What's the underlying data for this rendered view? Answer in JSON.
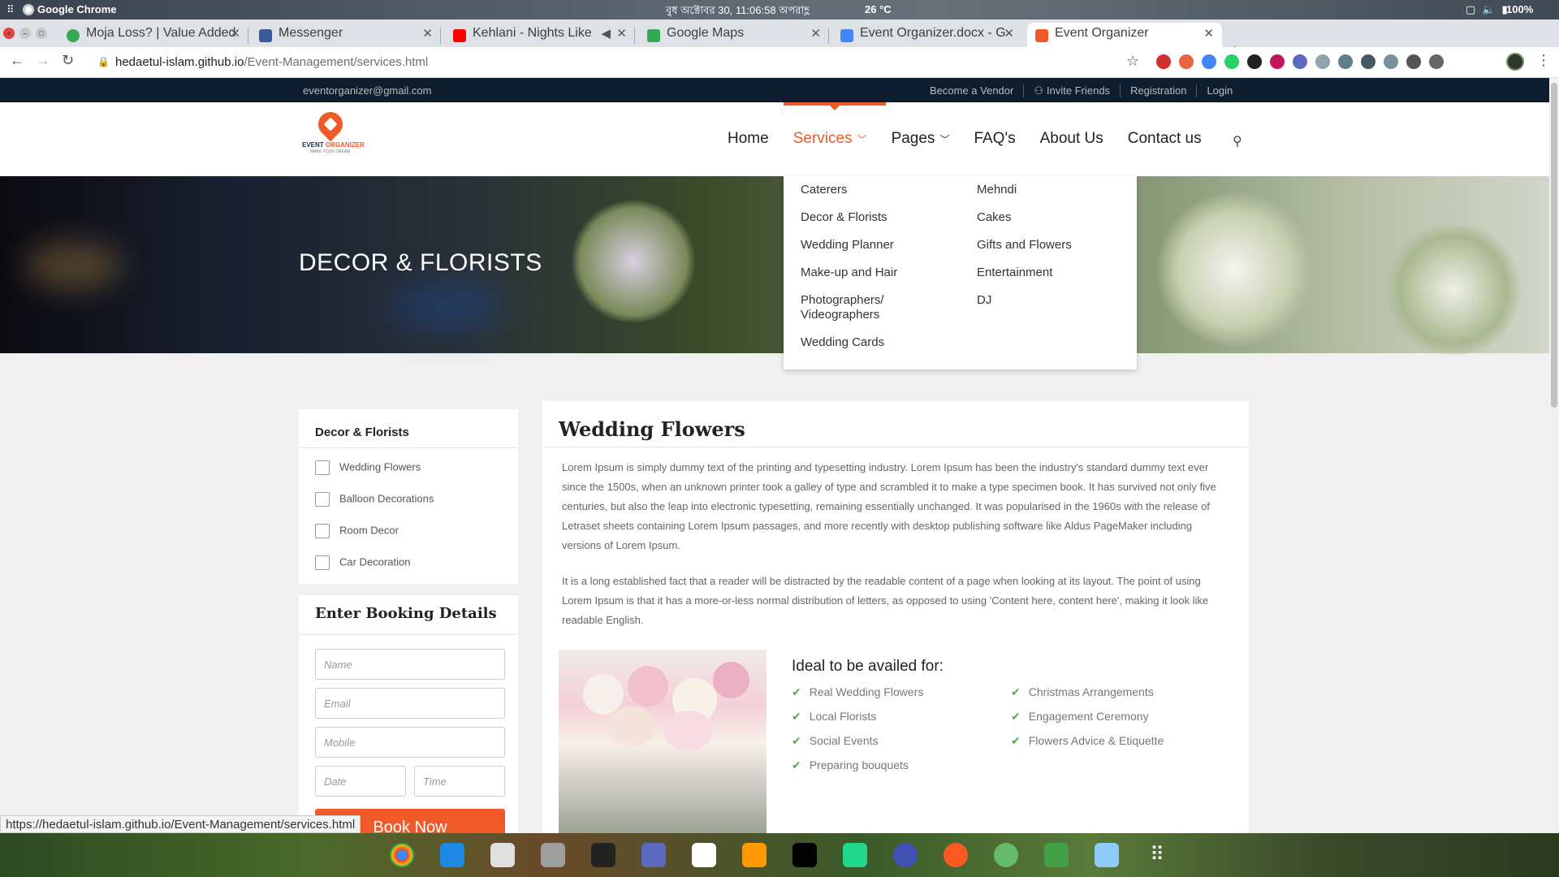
{
  "system": {
    "app_name": "Google Chrome",
    "clock": "বুধ অক্টোবর 30, 11:06:58 অপরাহ্ণ",
    "temperature": "26 °C",
    "battery": "100%"
  },
  "tabs": [
    {
      "title": "Moja Loss? | Value Added",
      "color": "#34a853"
    },
    {
      "title": "Messenger",
      "color": "#3b5998"
    },
    {
      "title": "Kehlani - Nights Like",
      "color": "#ff0000"
    },
    {
      "title": "Google Maps",
      "color": "#34a853"
    },
    {
      "title": "Event Organizer.docx - G",
      "color": "#4285f4"
    },
    {
      "title": "Event Organizer",
      "color": "#f05a28"
    }
  ],
  "address": {
    "host": "hedaetul-islam.github.io",
    "path": "/Event-Management/services.html"
  },
  "topbar": {
    "email": "eventorganizer@gmail.com",
    "links": [
      "Become a Vendor",
      "Invite Friends",
      "Registration",
      "Login"
    ]
  },
  "logo": {
    "brand_a": "EVENT",
    "brand_b": "ORGANIZER",
    "tagline": "MAKE YOUR DREAM"
  },
  "menu": {
    "home": "Home",
    "services": "Services",
    "pages": "Pages",
    "faq": "FAQ's",
    "about": "About Us",
    "contact": "Contact us"
  },
  "hero_title": "DECOR & FLORISTS",
  "dropdown": {
    "col1": [
      "Caterers",
      "Decor & Florists",
      "Wedding Planner",
      "Make-up and Hair",
      "Photographers/",
      "Videographers",
      "Wedding Cards"
    ],
    "col2": [
      "Mehndi",
      "Cakes",
      "Gifts and Flowers",
      "Entertainment",
      "DJ"
    ]
  },
  "sidebar": {
    "title": "Decor & Florists",
    "options": [
      "Wedding Flowers",
      "Balloon Decorations",
      "Room Decor",
      "Car Decoration"
    ]
  },
  "booking": {
    "title": "Enter Booking Details",
    "name_ph": "Name",
    "email_ph": "Email",
    "mobile_ph": "Mobile",
    "date_ph": "Date",
    "time_ph": "Time",
    "button": "Book Now"
  },
  "main": {
    "title": "Wedding Flowers",
    "para1": "Lorem Ipsum is simply dummy text of the printing and typesetting industry. Lorem Ipsum has been the industry's standard dummy text ever since the 1500s, when an unknown printer took a galley of type and scrambled it to make a type specimen book. It has survived not only five centuries, but also the leap into electronic typesetting, remaining essentially unchanged. It was popularised in the 1960s with the release of Letraset sheets containing Lorem Ipsum passages, and more recently with desktop publishing software like Aldus PageMaker including versions of Lorem Ipsum.",
    "para2": "It is a long established fact that a reader will be distracted by the readable content of a page when looking at its layout. The point of using Lorem Ipsum is that it has a more-or-less normal distribution of letters, as opposed to using 'Content here, content here', making it look like readable English.",
    "ideal_title": "Ideal to be availed for:",
    "features_left": [
      "Real Wedding Flowers",
      "Local Florists",
      "Social Events",
      "Preparing bouquets"
    ],
    "features_right": [
      "Christmas Arrangements",
      "Engagement Ceremony",
      "Flowers Advice & Etiquette"
    ]
  },
  "status_url": "https://hedaetul-islam.github.io/Event-Management/services.html",
  "colors": {
    "accent": "#f05a28",
    "topbar": "#0e1d2d",
    "check": "#4caf50"
  }
}
